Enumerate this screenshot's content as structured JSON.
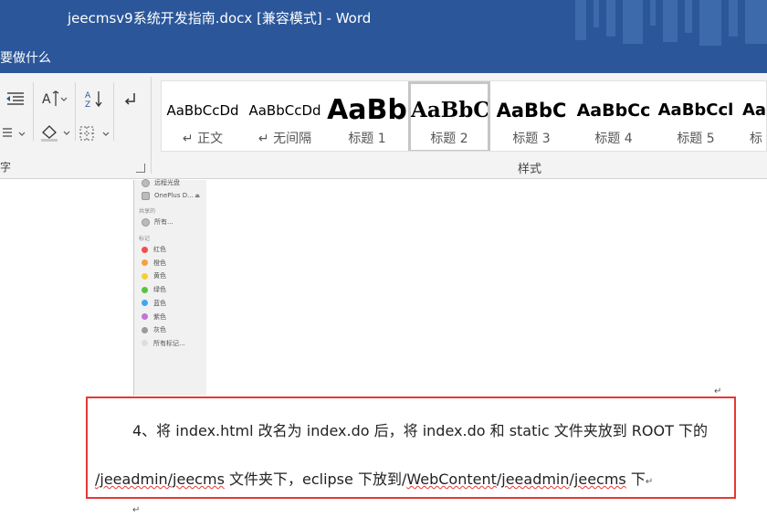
{
  "window": {
    "title": "jeecmsv9系统开发指南.docx [兼容模式]  -  Word",
    "title_bar_color": "#2b579a"
  },
  "tell_me": {
    "text": "要做什么"
  },
  "ribbon": {
    "paragraph_group": {
      "label": "字",
      "buttons": [
        {
          "icon": "decrease-indent-icon"
        },
        {
          "icon": "text-direction-icon"
        },
        {
          "icon": "sort-icon"
        },
        {
          "icon": "paragraph-mark-icon"
        },
        {
          "icon": "line-spacing-icon"
        },
        {
          "icon": "shading-icon"
        },
        {
          "icon": "borders-icon"
        }
      ],
      "sort_label": "A Z"
    },
    "styles_group": {
      "label": "样式",
      "styles": [
        {
          "sample": "AaBbCcDd",
          "name": "↵ 正文"
        },
        {
          "sample": "AaBbCcDd",
          "name": "↵ 无间隔"
        },
        {
          "sample": "AaBb",
          "name": "标题 1"
        },
        {
          "sample": "AaBbC",
          "name": "标题 2",
          "selected": true
        },
        {
          "sample": "AaBbC",
          "name": "标题 3"
        },
        {
          "sample": "AaBbCc",
          "name": "标题 4"
        },
        {
          "sample": "AaBbCcl",
          "name": "标题 5"
        },
        {
          "sample": "AaB",
          "name": "标"
        }
      ]
    }
  },
  "document": {
    "embedded_screenshot": {
      "rows": [
        {
          "label": "远程光盘",
          "kind": "disk"
        },
        {
          "label": "OnePlus D...",
          "kind": "disk",
          "eject": "⏏"
        }
      ],
      "shared_header": "共享的",
      "shared_rows": [
        {
          "label": "所有...",
          "kind": "globe"
        }
      ],
      "tags_header": "标记",
      "tags": [
        {
          "label": "红色",
          "color": "#f24e4e"
        },
        {
          "label": "橙色",
          "color": "#f6a13a"
        },
        {
          "label": "黄色",
          "color": "#f5cf32"
        },
        {
          "label": "绿色",
          "color": "#56c43c"
        },
        {
          "label": "蓝色",
          "color": "#3ea7f2"
        },
        {
          "label": "紫色",
          "color": "#c176d8"
        },
        {
          "label": "灰色",
          "color": "#9a9a9a"
        },
        {
          "label": "所有标记...",
          "color": "#dedede"
        }
      ]
    },
    "paragraph": {
      "line1": "4、将 index.html 改名为 index.do 后，将 index.do 和 static 文件夹放到 ROOT 下的",
      "line2_parts": [
        {
          "text": "/jeeadmin/jeecms",
          "spellcheck": true
        },
        {
          "text": " 文件夹下，eclipse 下放到/",
          "spellcheck": false
        },
        {
          "text": "WebContent",
          "spellcheck": true
        },
        {
          "text": "/",
          "spellcheck": false
        },
        {
          "text": "jeeadmin",
          "spellcheck": true
        },
        {
          "text": "/",
          "spellcheck": false
        },
        {
          "text": "jeecms",
          "spellcheck": true
        },
        {
          "text": " 下",
          "spellcheck": false
        }
      ],
      "end_mark": "↵"
    },
    "highlight_color": "#e53935"
  }
}
